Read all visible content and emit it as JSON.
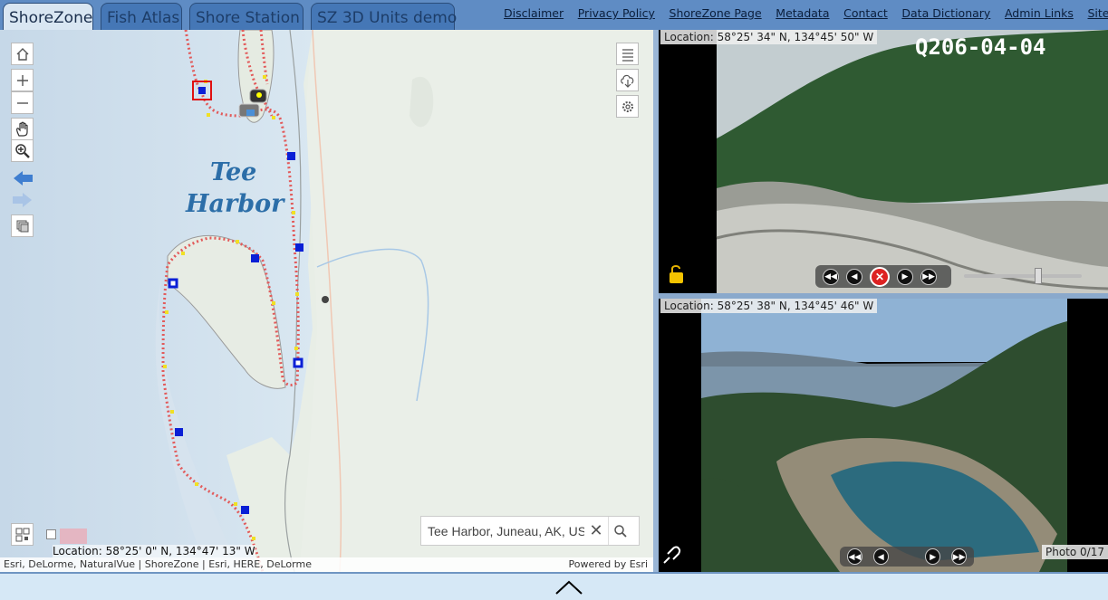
{
  "tabs": [
    {
      "label": "ShoreZone",
      "active": true
    },
    {
      "label": "Fish Atlas",
      "active": false
    },
    {
      "label": "Shore Station",
      "active": false
    },
    {
      "label": "SZ 3D Units demo",
      "active": false
    }
  ],
  "links": [
    "Disclaimer",
    "Privacy Policy",
    "ShoreZone Page",
    "Metadata",
    "Contact",
    "Data Dictionary",
    "Admin Links",
    "Site Info"
  ],
  "map": {
    "place_label_line1": "Tee",
    "place_label_line2": "Harbor",
    "search_value": "Tee Harbor, Juneau, AK, USA",
    "location": "Location: 58°25' 0\" N, 134°47' 13\" W",
    "attribution": "Esri, DeLorme, NaturalVue | ShoreZone | Esri, HERE, DeLorme",
    "powered_by": "Powered by Esri",
    "toolbar_icons": [
      "home-icon",
      "zoom-in-icon",
      "zoom-out-icon",
      "pan-hand-icon",
      "zoom-magnifier-icon",
      "back-arrow-icon",
      "forward-arrow-icon",
      "layers-icon"
    ],
    "right_icons": [
      "list-icon",
      "cloud-download-icon",
      "gear-icon"
    ]
  },
  "video": {
    "location": "Location: 58°25' 34\" N, 134°45' 50\" W",
    "overlay_text": "Q206-04-04",
    "slider_value": 0.6,
    "colors": {
      "sky": "#b8c8cf",
      "forest": "#2f5a32",
      "beach": "#8a8a82"
    }
  },
  "photo": {
    "location": "Location: 58°25' 38\" N, 134°45' 46\" W",
    "count": "Photo 0/17"
  },
  "colors": {
    "topbar": "#5f8cc4",
    "water": "#cfe0ee",
    "land": "#e9efe6",
    "track_red": "#e25a5a",
    "track_yellow": "#f0e024",
    "marker_blue": "#0a1fd6"
  }
}
